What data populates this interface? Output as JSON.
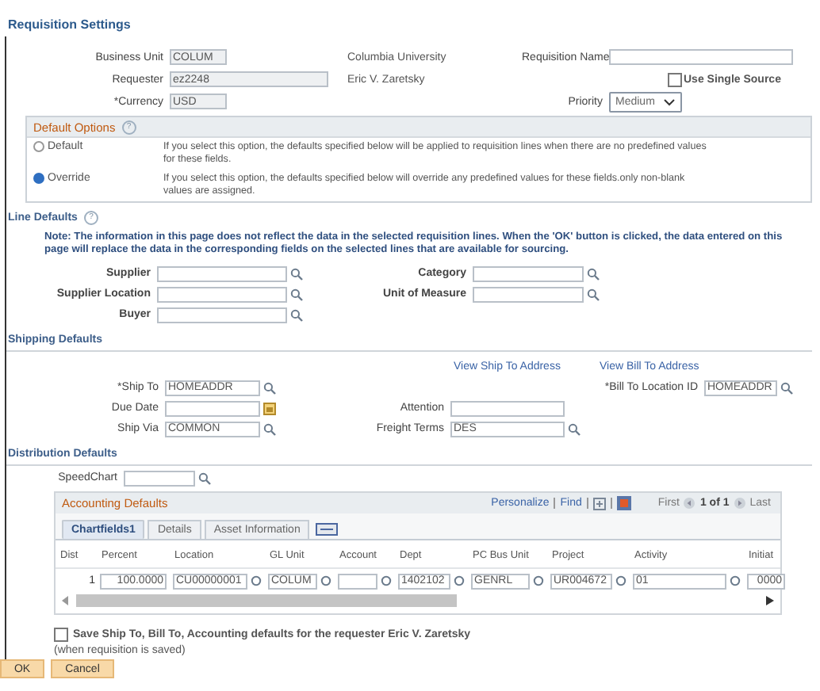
{
  "title": "Requisition Settings",
  "header": {
    "business_unit": {
      "label": "Business Unit",
      "value": "COLUM"
    },
    "business_unit_description": "Columbia University",
    "requisition_name": {
      "label": "Requisition Name"
    },
    "requester": {
      "label": "Requester",
      "value": "ez2248"
    },
    "requester_name": "Eric V. Zaretsky",
    "use_single_source": {
      "label": "Use Single Source",
      "checked": false
    },
    "currency": {
      "label": "*Currency",
      "value": "USD"
    },
    "priority": {
      "label": "Priority",
      "value": "Medium"
    }
  },
  "default_options": {
    "title": "Default Options",
    "help": "?",
    "options": [
      {
        "label": "Default",
        "description": "If you select this option, the defaults specified below will be applied to requisition lines when there are no predefined values for these fields.",
        "selected": false
      },
      {
        "label": "Override",
        "description": "If you select this option, the defaults specified below will override any predefined values for these fields.only non-blank values are assigned.",
        "selected": true
      }
    ]
  },
  "line_defaults": {
    "title": "Line Defaults",
    "help": "?",
    "note": "Note: The information in this page does not reflect the data in the selected requisition lines. When the 'OK' button is clicked, the data entered on this page will replace the data in the corresponding fields on the selected lines that are available for sourcing.",
    "left_fields": [
      {
        "label": "Supplier",
        "kind": "lookup"
      },
      {
        "label": "Supplier Location",
        "kind": "lookup"
      },
      {
        "label": "Buyer",
        "kind": "lookup"
      }
    ],
    "right_fields": [
      {
        "label": "Category",
        "kind": "lookup"
      },
      {
        "label": "Unit of Measure",
        "kind": "lookup"
      }
    ]
  },
  "shipping_defaults": {
    "title": "Shipping Defaults",
    "links": [
      "View Ship To Address",
      "View Bill To Address"
    ],
    "left_fields": [
      {
        "label": "*Ship To",
        "value": "HOMEADDR",
        "kind": "lookup"
      },
      {
        "label": "Due Date",
        "kind": "date"
      },
      {
        "label": "Ship Via",
        "value": "COMMON",
        "kind": "lookup"
      }
    ],
    "middle_fields": [
      {
        "label": "Attention",
        "kind": "text"
      },
      {
        "label": "Freight Terms",
        "value": "DES",
        "kind": "lookup"
      }
    ],
    "right_fields": [
      {
        "label": "*Bill To Location ID",
        "value": "HOMEADDR",
        "kind": "lookup"
      }
    ]
  },
  "distribution_defaults": {
    "title": "Distribution Defaults",
    "speedchart": {
      "label": "SpeedChart",
      "kind": "lookup"
    },
    "grid": {
      "title": "Accounting Defaults",
      "personalize": "Personalize",
      "find": "Find",
      "first": "First",
      "page": "1 of 1",
      "last": "Last",
      "tabs": [
        {
          "label": "Chartfields1",
          "selected": true
        },
        {
          "label": "Details",
          "selected": false
        },
        {
          "label": "Asset Information",
          "selected": false
        }
      ],
      "columns": [
        "Dist",
        "Percent",
        "Location",
        "GL Unit",
        "Account",
        "Dept",
        "PC Bus Unit",
        "Project",
        "Activity",
        "Initiat"
      ],
      "rows": [
        [
          {
            "value": "1",
            "kind": "plain"
          },
          {
            "value": "100.0000",
            "kind": "number"
          },
          {
            "value": "CU00000001",
            "kind": "lookup"
          },
          {
            "value": "COLUM",
            "kind": "lookup"
          },
          {
            "kind": "lookup"
          },
          {
            "value": "1402102",
            "kind": "lookup"
          },
          {
            "value": "GENRL",
            "kind": "lookup"
          },
          {
            "value": "UR004672",
            "kind": "lookup"
          },
          {
            "value": "01",
            "kind": "lookup"
          },
          {
            "value": "0000",
            "kind": "number"
          }
        ]
      ]
    }
  },
  "save_defaults": {
    "label": "Save Ship To, Bill To, Accounting defaults for the requester Eric V. Zaretsky",
    "note": "(when requisition is saved)",
    "checked": false
  },
  "buttons": [
    "OK",
    "Cancel"
  ]
}
